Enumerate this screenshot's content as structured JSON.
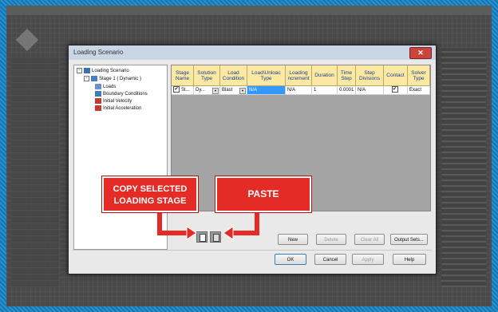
{
  "dialog": {
    "title": "Loading Scenario",
    "close_glyph": "✕"
  },
  "tree": {
    "root": "Loading Scenario",
    "stage": "Stage 1 ( Dynamic )",
    "items": [
      "Loads",
      "Boundary Conditions",
      "Initial Velocity",
      "Initial Acceleration"
    ]
  },
  "grid": {
    "columns": [
      "Stage Name",
      "Solution Type",
      "Load Condition",
      "Load\\Unloac Type",
      "Loading ncrement",
      "Duration",
      "Time Step",
      "Step Divisions",
      "Contact",
      "Solver Type"
    ],
    "row": {
      "stage_name": "St...",
      "solution_type": "Dy...",
      "load_condition": "Blast",
      "load_type": "N/A",
      "loading_increment": "N/A",
      "duration": "1",
      "time_step": "0.0001",
      "step_divisions": "N/A",
      "contact": "✔",
      "solver_type": "Exact"
    }
  },
  "buttons": {
    "new": "New",
    "delete": "Delete",
    "clear_all": "Clear All",
    "output_sets": "Output Sets...",
    "ok": "OK",
    "cancel": "Cancel",
    "apply": "Apply",
    "help": "Help"
  },
  "callouts": {
    "copy": "COPY SELECTED LOADING STAGE",
    "paste": "PASTE"
  },
  "colors": {
    "callout": "#e52b25",
    "header": "#fbe9a3",
    "selection": "#3399ff"
  }
}
